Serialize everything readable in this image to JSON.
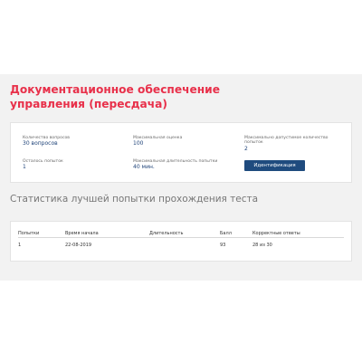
{
  "test": {
    "title": "Документационное обеспечение управления (пересдача)"
  },
  "info": {
    "questions_label": "Количество вопросов",
    "questions_value": "30 вопросов",
    "max_score_label": "Максимальная оценка",
    "max_score_value": "100",
    "max_attempts_label": "Максимально допустимое количество попыток",
    "max_attempts_value": "2",
    "attempts_left_label": "Осталось попыток",
    "attempts_left_value": "1",
    "max_duration_label": "Максимальная длительность попытки",
    "max_duration_value": "40 мин.",
    "identify_button": "Идентификация"
  },
  "stats": {
    "heading": "Статистика лучшей попытки прохождения теста",
    "columns": [
      "Попытки",
      "Время начала",
      "Длительность",
      "Балл",
      "Корректные ответы"
    ],
    "rows": [
      [
        "1",
        "22-08-2019",
        "",
        "93",
        "28 из 30"
      ]
    ]
  },
  "colors": {
    "title": "#e8304a",
    "accent": "#1f4b7e",
    "value_text": "#21457a",
    "background": "#f2f2f2"
  }
}
